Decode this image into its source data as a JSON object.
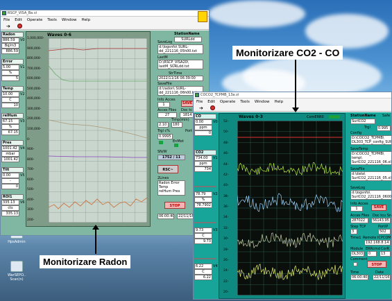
{
  "captions": {
    "co2": "Monitorizare CO2 - CO",
    "radon": "Monitorizare Radon"
  },
  "desktop": {
    "icons": [
      "HpsAdmin",
      "WarSEPO..\nScan(n)"
    ]
  },
  "radon_win": {
    "title": "RSCP_VISA_Ba.vi",
    "menu": [
      "File",
      "Edit",
      "Operate",
      "Tools",
      "Window",
      "Help"
    ],
    "left": [
      {
        "name": "Radon",
        "val": "886.59",
        "unit": "Bq/m3",
        "val2": "886.59",
        "tag": "V0"
      },
      {
        "name": "Error",
        "val": "5.00",
        "unit": "%",
        "val2": "5",
        "tag": "V1"
      },
      {
        "name": "Temp",
        "val": "10.00",
        "unit": "C",
        "val2": "10",
        "tag": "V2"
      },
      {
        "name": "relHum",
        "val": "67.15",
        "unit": "%",
        "val2": "67.15",
        "tag": "V3"
      },
      {
        "name": "Pres",
        "val": "1001.42",
        "unit": "mbar",
        "val2": "1001.42",
        "tag": "V4"
      },
      {
        "name": "Tilt",
        "val": "0.00",
        "unit": "-",
        "val2": "0",
        "tag": "V5"
      },
      {
        "name": "ROI1",
        "val": "335.13",
        "unit": "cts",
        "val2": "335.13",
        "tag": "V6"
      }
    ],
    "graph_title": "Waves 0-6",
    "yticks": [
      "1,000,000-",
      "900,000-",
      "800,000-",
      "700,000-",
      "600,000-",
      "500,000-",
      "400,000-",
      "300,000-",
      "200,000-",
      "100,000-",
      "0-",
      "900-",
      "800-",
      "700-",
      "600-",
      "500-",
      "400-",
      "300-",
      "200-"
    ],
    "right": {
      "station_label": "StationName",
      "station_val": "SURLdd",
      "savelog_label": "SaveLog",
      "savelog_val": "d:\\logsnfo\\ SURL-dd_221116_05h00.txt",
      "lastm_label": "LastM",
      "lastm_val": "D:\\RSCP_VISA20\\ lastM_SURLdd.txt",
      "strtime_label": "StrTime",
      "strtime_val": "2022/11/16 06:39:00",
      "savefile_label": "SaveFile",
      "savefile_val": "d:\\radon\\ SURL-dd_221116_06h00.txt",
      "infoacces_label": "Info Acces",
      "infoacces_val": "1",
      "save_btn": "SAVE",
      "accesfiles_label": "Acces Files",
      "accesfiles_val": "27",
      "doctc_label": "Doc tc",
      "doctc_val": "1814",
      "timpmin_label": "Timp(min)",
      "v1": "2.10",
      "v2": "180",
      "trgl_label": "Trgl c%",
      "trgl_val": "0.9995",
      "enmot_label": "EnMot",
      "port_label": "Port",
      "snw_label": "SN/W",
      "snw_val": "1752 / 11",
      "rsc_btn": "RSC~",
      "lines_label": "2Lines",
      "list": [
        "Radon Error",
        "Temp",
        "relHum Pres"
      ],
      "stop_btn": "STOP",
      "time_val": "06:00:40",
      "date_val": "22/11/16"
    }
  },
  "co2_win": {
    "title": "COCO2_TCPMB_13a.vi",
    "menu": [
      "File",
      "Edit",
      "Operate",
      "Tools",
      "Window",
      "Help"
    ],
    "graph_title": "Waves 0-3",
    "graph_tag": "ComERR0",
    "left": [
      {
        "name": "CO",
        "val": "0.00",
        "unit": "ppm",
        "val2": "0",
        "tag": "V0"
      },
      {
        "name": "CO2",
        "val": "734.00",
        "unit": "ppm",
        "val2": "734",
        "tag": "V1"
      },
      {
        "name": "",
        "val": "78.79",
        "unit": "%",
        "val2": "78.7902",
        "tag": "V2"
      },
      {
        "name": "",
        "val": "9.73",
        "unit": "C",
        "val2": "9.73",
        "tag": "V3"
      },
      {
        "name": "",
        "val": "6.22",
        "unit": "C",
        "val2": "6.22",
        "tag": "V4"
      }
    ],
    "yticks": [
      "52-",
      "50-",
      "48-",
      "46-",
      "44-",
      "42-",
      "40-",
      "38-",
      "36-",
      "34-",
      "32-",
      "30-",
      "28-",
      "26-",
      "24-",
      "22-",
      "20-"
    ],
    "right": {
      "station_label": "StationName",
      "station_val": "SurlCO2",
      "sasfe_label": "Safe",
      "trgl_label": "Trgl",
      "trgl_val": "0.995",
      "config_label": "Config",
      "config_val": "D:\\COCO2_TCPMB\\ DL303_TCP_config_SURL.txt",
      "savetemp_label": "SaveTemp",
      "savetemp_val": "D:\\COCO2_TCPMB\\ temp\\ SurlCO2_221116_06.xls",
      "savefile_label": "SaveFile",
      "savefile_val": "d:\\data\\ SurlCO2_221116_05.xls",
      "savelog_label": "SaveLog",
      "savelog_val": "d:\\logsnfo\\ SurlCO2_221116_06000.txt",
      "infoacces_label": "Info Acces",
      "infoacces_val": "1",
      "save_btn": "SAVE",
      "accesfiles_label": "Acces Files",
      "accesfiles_val": "287022",
      "docs_label": "Doc tcu Sn",
      "docs_val": "56143.95",
      "step_label": "Step TCP",
      "stepnum": "3",
      "portip_label": "PortIP",
      "portip_val": "502",
      "time1_label": "Time1",
      "remote_label": "Remote ICPCOM",
      "remote_val": "192.168.8.14",
      "module_label": "Module",
      "module_val": "DL303",
      "erricmd_label": "ERRcmd",
      "erricmd_val": "0",
      "coro_label": "CorR",
      "coro_val": "13",
      "comment_label": "Comment",
      "stop_btn": "STOP",
      "time_label": "Time",
      "time_val": "06:00:40",
      "date_label": "Date",
      "date_val": "22/11/16"
    }
  }
}
